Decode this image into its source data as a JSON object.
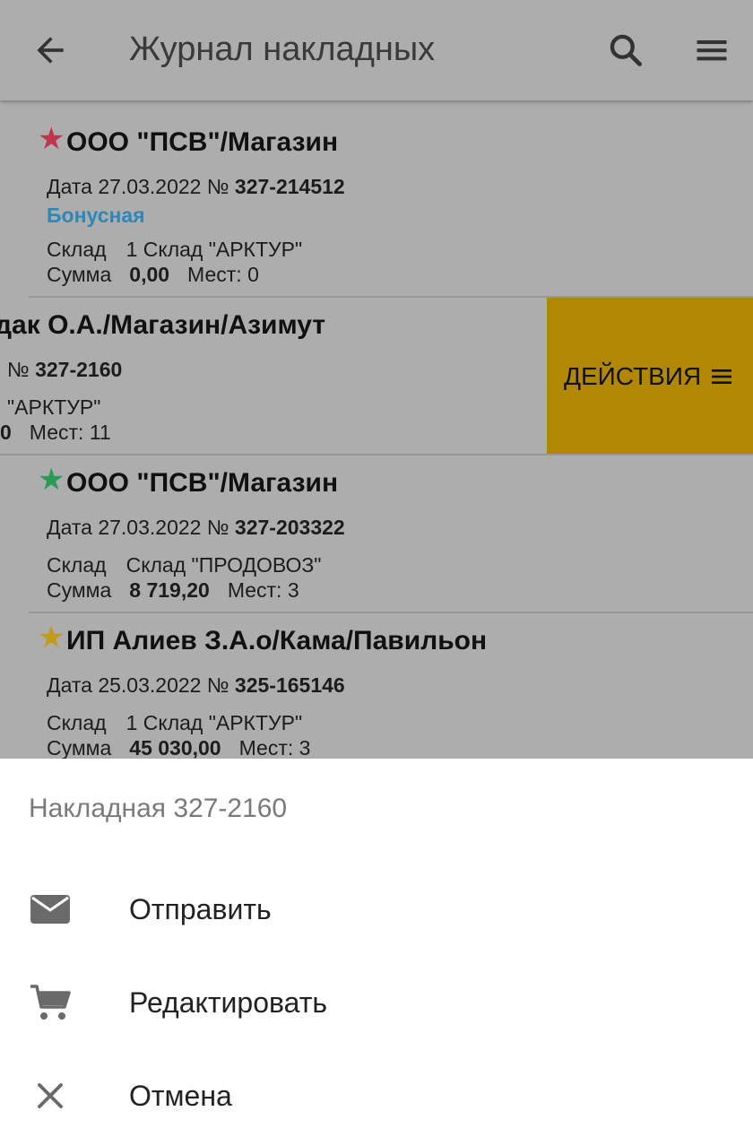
{
  "app_bar": {
    "title": "Журнал накладных",
    "back_icon": "arrow-left-icon",
    "search_icon": "search-icon",
    "menu_icon": "hamburger-menu-icon"
  },
  "labels": {
    "date_prefix": "Дата",
    "number_prefix": "№",
    "warehouse_label": "Склад",
    "sum_label": "Сумма",
    "places_label": "Мест:"
  },
  "invoices": [
    {
      "client": "ООО \"ПСВ\"/Магазин",
      "star_color": "#c0354b",
      "date": "27.03.2022",
      "number": "327-214512",
      "tag": "Бонусная",
      "warehouse": "1 Склад \"АРКТУР\"",
      "sum": "0,00",
      "places": "0"
    },
    {
      "client": "дак О.А./Магазин/Азимут",
      "number_fragment": "№",
      "number": "327-2160",
      "warehouse": "\"АРКТУР\"",
      "sum": "0",
      "places": "11",
      "action_label": "ДЕЙСТВИЯ",
      "action_icon": "hamburger-menu-icon",
      "action_color": "#b08804"
    },
    {
      "client": "ООО \"ПСВ\"/Магазин",
      "star_color": "#2a9a55",
      "date": "27.03.2022",
      "number": "327-203322",
      "warehouse": "Склад \"ПРОДОВОЗ\"",
      "sum": "8 719,20",
      "places": "3"
    },
    {
      "client": "ИП Алиев З.А.о/Кама/Павильон",
      "star_color": "#c49a1a",
      "date": "25.03.2022",
      "number": "325-165146",
      "warehouse": "1 Склад \"АРКТУР\"",
      "sum": "45 030,00",
      "places": "3"
    }
  ],
  "sheet": {
    "title": "Накладная 327-2160",
    "options": [
      {
        "label": "Отправить",
        "icon": "envelope-icon"
      },
      {
        "label": "Редактировать",
        "icon": "shopping-cart-icon"
      },
      {
        "label": "Отмена",
        "icon": "close-icon"
      }
    ]
  }
}
